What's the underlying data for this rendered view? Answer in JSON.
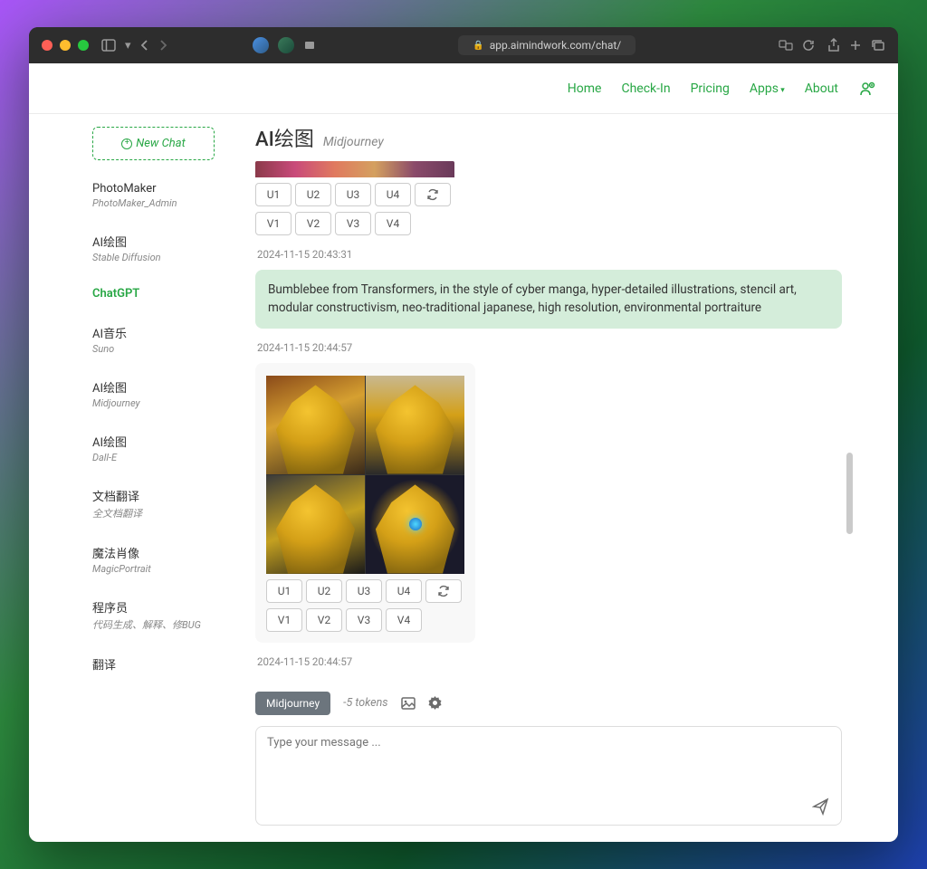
{
  "browser": {
    "url": "app.aimindwork.com/chat/"
  },
  "nav": {
    "home": "Home",
    "checkin": "Check-In",
    "pricing": "Pricing",
    "apps": "Apps",
    "about": "About"
  },
  "sidebar": {
    "new_chat": "New Chat",
    "items": [
      {
        "title": "PhotoMaker",
        "sub": "PhotoMaker_Admin",
        "active": false
      },
      {
        "title": "AI绘图",
        "sub": "Stable Diffusion",
        "active": false
      },
      {
        "title": "ChatGPT",
        "sub": "",
        "active": true
      },
      {
        "title": "AI音乐",
        "sub": "Suno",
        "active": false
      },
      {
        "title": "AI绘图",
        "sub": "Midjourney",
        "active": false
      },
      {
        "title": "AI绘图",
        "sub": "Dall-E",
        "active": false
      },
      {
        "title": "文档翻译",
        "sub": "全文档翻译",
        "active": false
      },
      {
        "title": "魔法肖像",
        "sub": "MagicPortrait",
        "active": false
      },
      {
        "title": "程序员",
        "sub": "代码生成、解释、修BUG",
        "active": false
      },
      {
        "title": "翻译",
        "sub": "",
        "active": false
      }
    ]
  },
  "heading": {
    "title": "AI绘图",
    "subtitle": "Midjourney"
  },
  "actions": {
    "u": [
      "U1",
      "U2",
      "U3",
      "U4"
    ],
    "v": [
      "V1",
      "V2",
      "V3",
      "V4"
    ]
  },
  "timestamps": {
    "t1": "2024-11-15 20:43:31",
    "t2": "2024-11-15 20:44:57",
    "t3": "2024-11-15 20:44:57"
  },
  "prompt": "Bumblebee from Transformers, in the style of cyber manga, hyper-detailed illustrations, stencil art, modular constructivism, neo-traditional japanese, high resolution, environmental portraiture",
  "input": {
    "model": "Midjourney",
    "tokens": "-5 tokens",
    "placeholder": "Type your message ..."
  }
}
